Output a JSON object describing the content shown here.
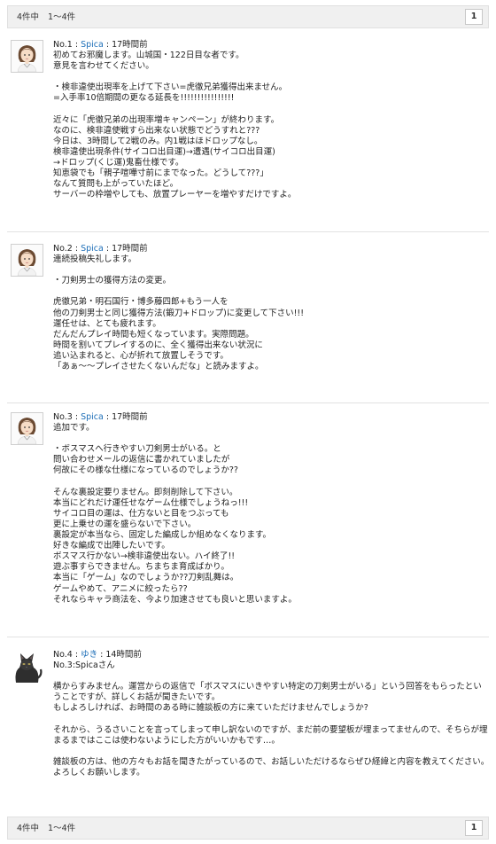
{
  "pager": {
    "count": "4件中",
    "range": "1〜4件",
    "page": "1"
  },
  "posts": [
    {
      "no": "No.1",
      "user": "Spica",
      "time": "17時間前",
      "lines": [
        "初めてお邪魔します。山城国・122日目な者です。",
        "意見を言わせてください。",
        "",
        "・検非違使出現率を上げて下さい=虎徹兄弟獲得出来ません。",
        "=入手率10倍期間の更なる延長を!!!!!!!!!!!!!!!!",
        "",
        "近々に「虎徹兄弟の出現率増キャンペーン」が終わります。",
        "なのに、検非違使戦すら出来ない状態でどうすれと???",
        "今日は、3時間して2戦のみ。内1戦はほドロップなし。",
        "検非違使出現条件(サイコロ出目運)→遭遇(サイコロ出目運)",
        "→ドロップ(くじ運)鬼畜仕様です。",
        "知恵袋でも「親子喧嘩寸前にまでなった。どうして???」",
        "なんて質問も上がっていたほど。",
        "サーバーの枠増やしても、放置プレーヤーを増やすだけですよ。"
      ]
    },
    {
      "no": "No.2",
      "user": "Spica",
      "time": "17時間前",
      "lines": [
        "連続投稿失礼します。",
        "",
        "・刀剣男士の獲得方法の変更。",
        "",
        "虎徹兄弟・明石国行・博多藤四郎+もう一人を",
        "他の刀剣男士と同じ獲得方法(鍛刀+ドロップ)に変更して下さい!!!",
        "運任せは、とても疲れます。",
        "だんだんプレイ時間も短くなっています。実際問題。",
        "時間を割いてプレイするのに、全く獲得出来ない状況に",
        "追い込まれると、心が折れて放置しそうです。",
        "「あぁ〜〜プレイさせたくないんだな」と読みますよ。"
      ]
    },
    {
      "no": "No.3",
      "user": "Spica",
      "time": "17時間前",
      "lines": [
        "追加です。",
        "",
        "・ボスマスへ行きやすい刀剣男士がいる。と",
        "問い合わせメールの返信に書かれていましたが",
        "何故にその様な仕様になっているのでしょうか??",
        "",
        "そんな裏設定要りません。即刻削除して下さい。",
        "本当にどれだけ運任せなゲーム仕様でしょうねっ!!!",
        "サイコロ目の運は、仕方ないと目をつぶっても",
        "更に上乗せの運を盛らないで下さい。",
        "裏設定が本当なら、固定した編成しか組めなくなります。",
        "好きな編成で出陣したいです。",
        "ボスマス行かない→検非違使出ない。ハイ終了!!",
        "遊ぶ事すらできません。ちまちま育成ばかり。",
        "本当に「ゲーム」なのでしょうか??刀剣乱舞は。",
        "ゲームやめて、アニメに絞ったら??",
        "それならキャラ商法を、今より加速させても良いと思いますよ。"
      ]
    },
    {
      "no": "No.4",
      "user": "ゆき",
      "time": "14時間前",
      "lines": [
        "No.3:Spicaさん",
        "",
        "横からすみません。運営からの返信で「ボスマスにいきやすい特定の刀剣男士がいる」という回答をもらったということですが、詳しくお話が聞きたいです。",
        "もしよろしければ、お時間のある時に雑談板の方に来ていただけませんでしょうか?",
        "",
        "それから、うるさいことを言ってしまって申し訳ないのですが、まだ前の要望板が埋まってませんので、そちらが埋まるまではここは使わないようにした方がいいかもです…。",
        "",
        "雑談板の方は、他の方々もお話を聞きたがっているので、お話しいただけるならぜひ経緯と内容を教えてください。",
        "よろしくお願いします。"
      ]
    }
  ]
}
